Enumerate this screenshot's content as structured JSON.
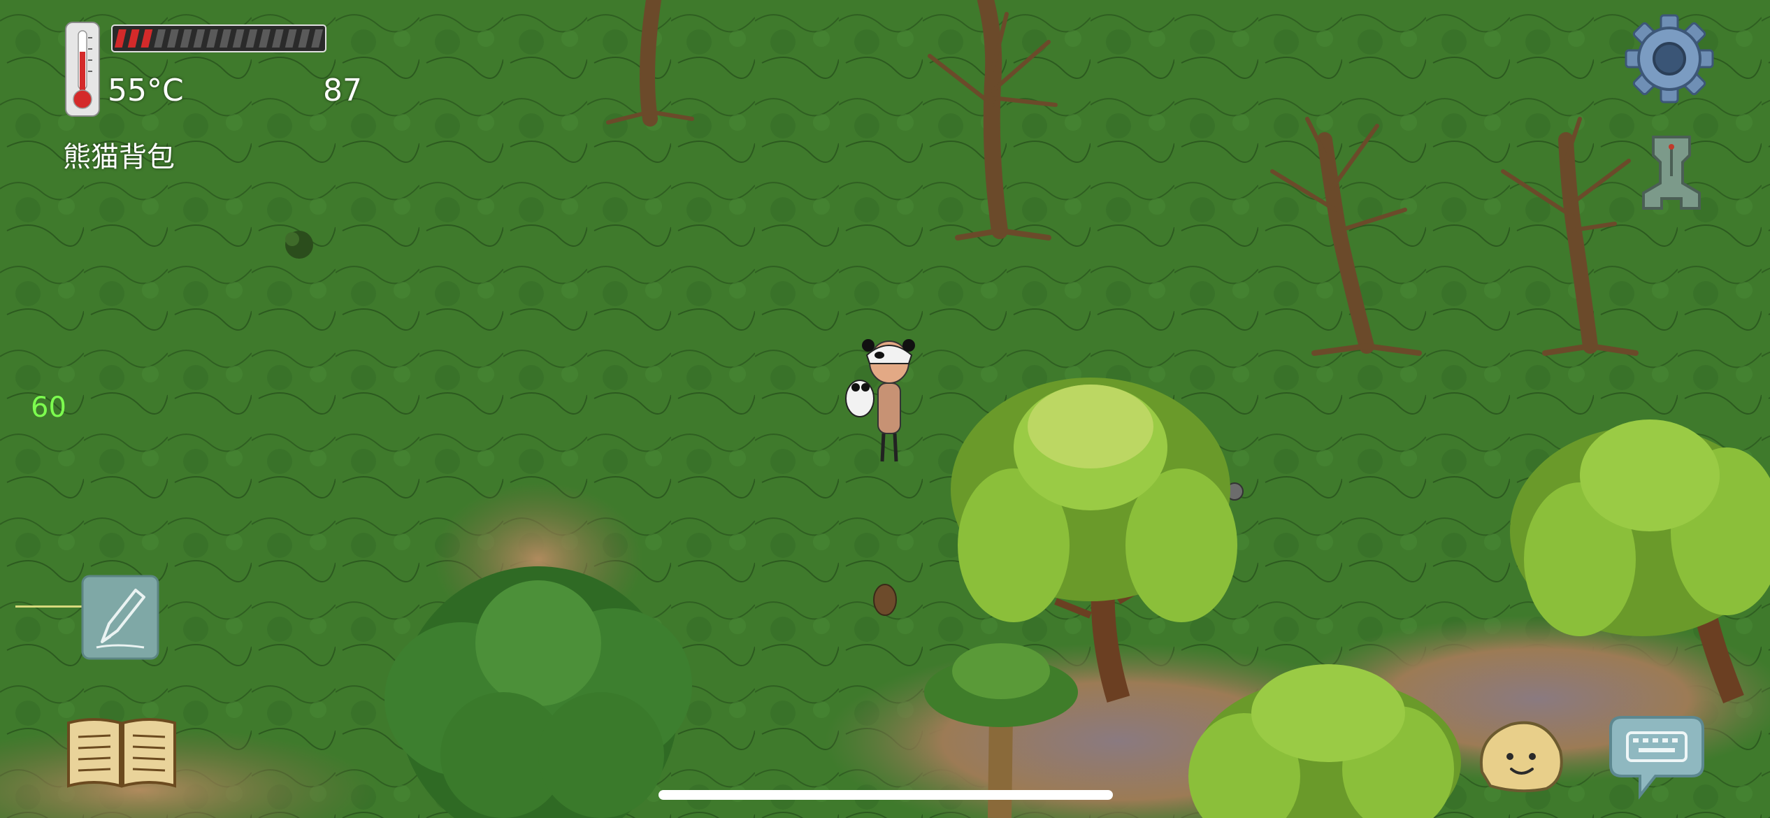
{
  "hud": {
    "temperature": "55°C",
    "food_count": "87",
    "held_item": "熊猫背包",
    "fps": "60",
    "hunger_filled_segments": 3,
    "hunger_total_segments": 16
  },
  "icons": {
    "thermometer": "thermometer-icon",
    "settings": "gear-icon",
    "tech_tree": "tech-tree-icon",
    "write_note": "pencil-icon",
    "recipe_book": "book-icon",
    "emote": "emote-face-icon",
    "chat": "keyboard-chat-icon"
  },
  "colors": {
    "grass": "#3f7a2c",
    "hunger_full": "#d42a2a",
    "hunger_empty": "#5a5a5a",
    "fps": "#7dff4f"
  }
}
